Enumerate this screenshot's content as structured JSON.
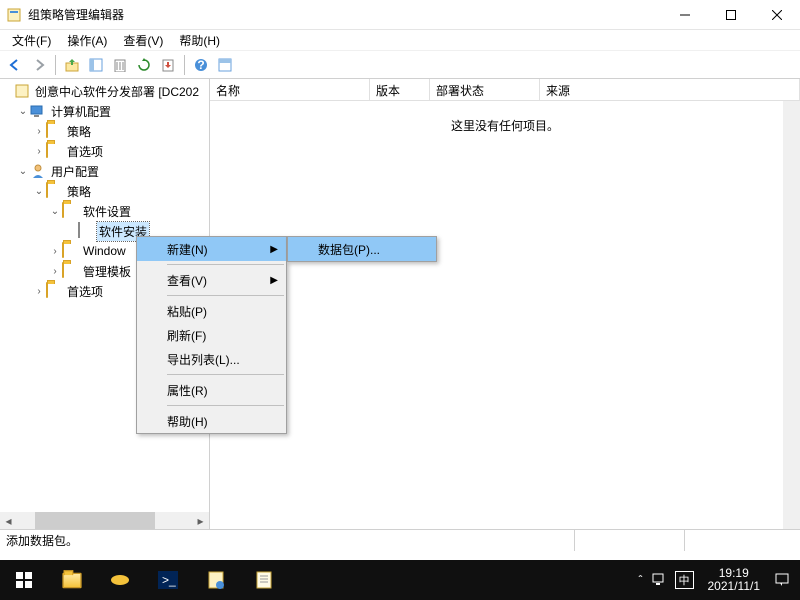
{
  "window": {
    "title": "组策略管理编辑器"
  },
  "menubar": [
    {
      "label": "文件(F)"
    },
    {
      "label": "操作(A)"
    },
    {
      "label": "查看(V)"
    },
    {
      "label": "帮助(H)"
    }
  ],
  "tree": {
    "root": "创意中心软件分发部署 [DC202",
    "computer_config": "计算机配置",
    "policies": "策略",
    "preferences": "首选项",
    "user_config": "用户配置",
    "software_settings": "软件设置",
    "software_install": "软件安装",
    "windows": "Window",
    "admin_templates": "管理模板"
  },
  "list": {
    "cols": {
      "name": "名称",
      "version": "版本",
      "deploy_state": "部署状态",
      "source": "来源"
    },
    "empty": "这里没有任何项目。"
  },
  "ctx": {
    "new": "新建(N)",
    "view": "查看(V)",
    "paste": "粘贴(P)",
    "refresh": "刷新(F)",
    "export_list": "导出列表(L)...",
    "properties": "属性(R)",
    "help": "帮助(H)",
    "package": "数据包(P)..."
  },
  "status": {
    "text": "添加数据包。"
  },
  "taskbar": {
    "time": "19:19",
    "date": "2021/11/1",
    "ime": "中"
  }
}
